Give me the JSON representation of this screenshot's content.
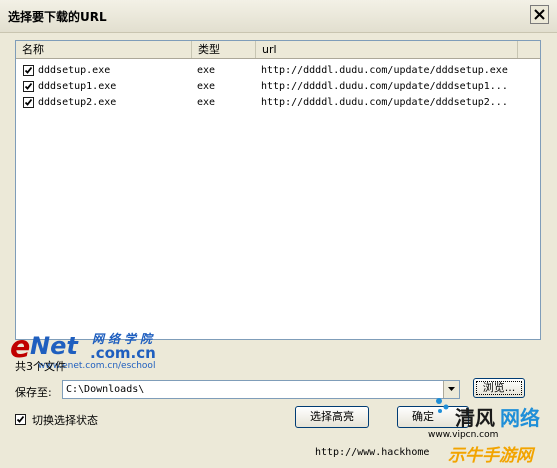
{
  "window": {
    "title": "选择要下载的URL"
  },
  "list": {
    "columns": [
      "名称",
      "类型",
      "url"
    ],
    "rows": [
      {
        "checked": true,
        "name": "dddsetup.exe",
        "type": "exe",
        "url": "http://ddddl.dudu.com/update/dddsetup.exe"
      },
      {
        "checked": true,
        "name": "dddsetup1.exe",
        "type": "exe",
        "url": "http://ddddl.dudu.com/update/dddsetup1..."
      },
      {
        "checked": true,
        "name": "dddsetup2.exe",
        "type": "exe",
        "url": "http://ddddl.dudu.com/update/dddsetup2..."
      }
    ]
  },
  "watermarks": {
    "enet_e": "e",
    "enet_net": "Net",
    "enet_cn": ".com.cn",
    "enet_cn_chars": "网络学院",
    "enet_url": "www.enet.com.cn/eschool",
    "hackhome": "http://www.hackhome",
    "qingfeng_1": "清风",
    "qingfeng_2": "网络",
    "vipcn": "www.vipcn.com",
    "game": "示牛手游网"
  },
  "footer": {
    "count_label": "共3个文件",
    "save_label": "保存至:",
    "save_path": "C:\\Downloads\\",
    "browse_label": "浏览...",
    "select_high_label": "选择高亮",
    "ok_label": "确定",
    "toggle_label": "切换选择状态",
    "toggle_checked": true
  },
  "colors": {
    "face": "#ece9d8",
    "list_border": "#7f9db9",
    "button_border": "#003c74",
    "watermark_red": "#c00000",
    "watermark_blue": "#1f5fbf"
  }
}
